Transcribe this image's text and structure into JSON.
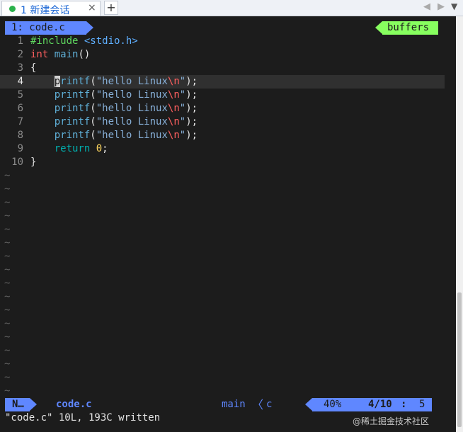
{
  "window": {
    "tab": {
      "label": "1 新建会话",
      "close": "×"
    },
    "add_tab": "+",
    "nav": {
      "prev": "◀",
      "next": "▶",
      "menu": "▼"
    }
  },
  "vim": {
    "tabline": {
      "buffer": "1: code.c",
      "right_label": "buffers"
    },
    "code_lines": [
      {
        "num": "1",
        "tokens": [
          {
            "t": "#include ",
            "c": "c-pre"
          },
          {
            "t": "<stdio.h>",
            "c": "c-inc"
          }
        ]
      },
      {
        "num": "2",
        "tokens": [
          {
            "t": "int",
            "c": "c-type"
          },
          {
            "t": " ",
            "c": "c-punct"
          },
          {
            "t": "main",
            "c": "c-func"
          },
          {
            "t": "()",
            "c": "c-punct"
          }
        ]
      },
      {
        "num": "3",
        "tokens": [
          {
            "t": "{",
            "c": "c-punct"
          }
        ]
      },
      {
        "num": "4",
        "cursor": true,
        "tokens": [
          {
            "t": "    ",
            "c": "c-punct"
          },
          {
            "t": "p",
            "c": "c-func c-cur"
          },
          {
            "t": "rintf",
            "c": "c-func"
          },
          {
            "t": "(",
            "c": "c-punct"
          },
          {
            "t": "\"hello Linux",
            "c": "c-str"
          },
          {
            "t": "\\n",
            "c": "c-esc"
          },
          {
            "t": "\"",
            "c": "c-str"
          },
          {
            "t": ");",
            "c": "c-punct"
          }
        ]
      },
      {
        "num": "5",
        "tokens": [
          {
            "t": "    ",
            "c": "c-punct"
          },
          {
            "t": "printf",
            "c": "c-func"
          },
          {
            "t": "(",
            "c": "c-punct"
          },
          {
            "t": "\"hello Linux",
            "c": "c-str"
          },
          {
            "t": "\\n",
            "c": "c-esc"
          },
          {
            "t": "\"",
            "c": "c-str"
          },
          {
            "t": ");",
            "c": "c-punct"
          }
        ]
      },
      {
        "num": "6",
        "tokens": [
          {
            "t": "    ",
            "c": "c-punct"
          },
          {
            "t": "printf",
            "c": "c-func"
          },
          {
            "t": "(",
            "c": "c-punct"
          },
          {
            "t": "\"hello Linux",
            "c": "c-str"
          },
          {
            "t": "\\n",
            "c": "c-esc"
          },
          {
            "t": "\"",
            "c": "c-str"
          },
          {
            "t": ");",
            "c": "c-punct"
          }
        ]
      },
      {
        "num": "7",
        "tokens": [
          {
            "t": "    ",
            "c": "c-punct"
          },
          {
            "t": "printf",
            "c": "c-func"
          },
          {
            "t": "(",
            "c": "c-punct"
          },
          {
            "t": "\"hello Linux",
            "c": "c-str"
          },
          {
            "t": "\\n",
            "c": "c-esc"
          },
          {
            "t": "\"",
            "c": "c-str"
          },
          {
            "t": ");",
            "c": "c-punct"
          }
        ]
      },
      {
        "num": "8",
        "tokens": [
          {
            "t": "    ",
            "c": "c-punct"
          },
          {
            "t": "printf",
            "c": "c-func"
          },
          {
            "t": "(",
            "c": "c-punct"
          },
          {
            "t": "\"hello Linux",
            "c": "c-str"
          },
          {
            "t": "\\n",
            "c": "c-esc"
          },
          {
            "t": "\"",
            "c": "c-str"
          },
          {
            "t": ");",
            "c": "c-punct"
          }
        ]
      },
      {
        "num": "9",
        "tokens": [
          {
            "t": "    ",
            "c": "c-punct"
          },
          {
            "t": "return",
            "c": "c-kw"
          },
          {
            "t": " ",
            "c": "c-punct"
          },
          {
            "t": "0",
            "c": "c-num"
          },
          {
            "t": ";",
            "c": "c-punct"
          }
        ]
      },
      {
        "num": "10",
        "tokens": [
          {
            "t": "}",
            "c": "c-punct"
          }
        ]
      }
    ],
    "empty_marker": "~",
    "empty_line_count": 17,
    "statusline": {
      "mode": "N…",
      "file": "code.c",
      "function": "main",
      "separator": "〈",
      "filetype": "c",
      "percent": "40%",
      "line": "4/10",
      "colon": ":",
      "column": "5"
    },
    "message": "\"code.c\" 10L, 193C written"
  },
  "watermark": "@稀土掘金技术社区",
  "colors": {
    "background": "#1c1c1c",
    "accent_blue": "#5f87ff",
    "accent_green": "#87ff5f"
  }
}
